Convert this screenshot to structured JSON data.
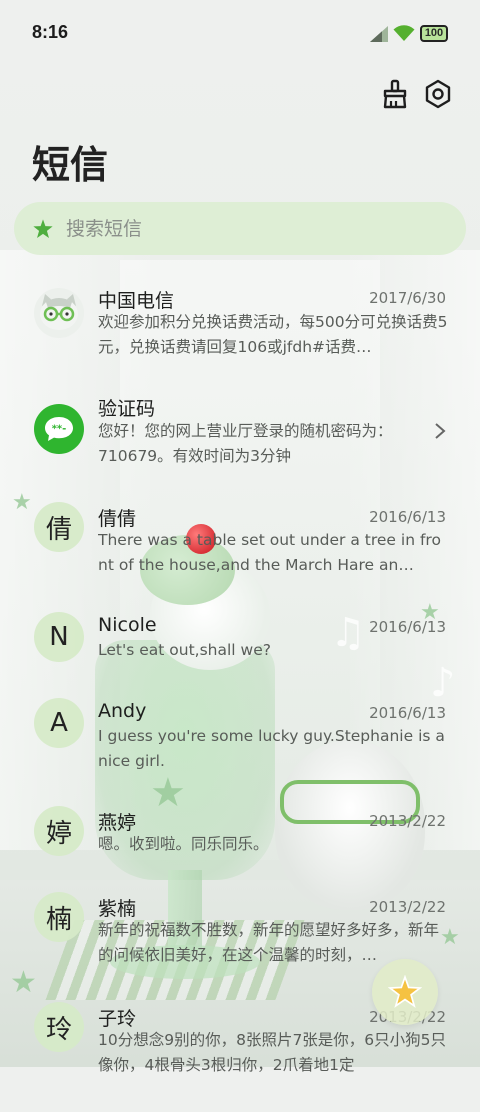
{
  "status_bar": {
    "time": "8:16",
    "battery": "100"
  },
  "header": {
    "title": "短信",
    "clean_icon": "broom-icon",
    "settings_icon": "settings-hexagon-icon"
  },
  "search": {
    "placeholder": "搜索短信",
    "icon": "star-icon"
  },
  "messages": [
    {
      "avatar_type": "cat-image",
      "avatar_text": "",
      "name": "中国电信",
      "date": "2017/6/30",
      "preview": "欢迎参加积分兑换话费活动，每500分可兑换话费5元，兑换话费请回复106或jfdh#话费…"
    },
    {
      "avatar_type": "chat-bubble",
      "avatar_text": "",
      "name": "验证码",
      "date": "",
      "preview": "您好！您的网上营业厅登录的随机密码为：710679。有效时间为3分钟"
    },
    {
      "avatar_type": "letter",
      "avatar_text": "倩",
      "name": "倩倩",
      "date": "2016/6/13",
      "preview": "There was a table set out under a tree in front of the house,and the March Hare an…"
    },
    {
      "avatar_type": "letter",
      "avatar_text": "N",
      "name": "Nicole",
      "date": "2016/6/13",
      "preview": "Let's eat out,shall we?"
    },
    {
      "avatar_type": "letter",
      "avatar_text": "A",
      "name": "Andy",
      "date": "2016/6/13",
      "preview": "I guess you're some lucky guy.Stephanie is a nice girl."
    },
    {
      "avatar_type": "letter",
      "avatar_text": "婷",
      "name": "燕婷",
      "date": "2013/2/22",
      "preview": "嗯。收到啦。同乐同乐。"
    },
    {
      "avatar_type": "letter",
      "avatar_text": "楠",
      "name": "紫楠",
      "date": "2013/2/22",
      "preview": "新年的祝福数不胜数，新年的愿望好多好多，新年的问候依旧美好，在这个温馨的时刻，…"
    },
    {
      "avatar_type": "letter",
      "avatar_text": "玲",
      "name": "子玲",
      "date": "2013/2/22",
      "preview": "10分想念9别的你，8张照片7张是你，6只小狗5只像你，4根骨头3根归你，2爪着地1定"
    }
  ],
  "fab": {
    "icon": "star-compose-icon"
  },
  "colors": {
    "accent_green": "#4fae3f",
    "avatar_bg": "#d6eac8",
    "search_bg": "#dceed2",
    "chat_icon_green": "#2fb52f"
  }
}
